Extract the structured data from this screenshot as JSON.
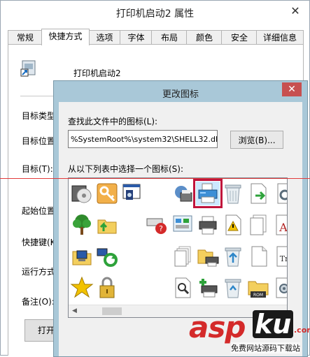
{
  "properties": {
    "title": "打印机启动2 属性",
    "close_glyph": "✕",
    "tabs": [
      "常规",
      "快捷方式",
      "选项",
      "字体",
      "布局",
      "颜色",
      "安全",
      "详细信息"
    ],
    "shortcut_name": "打印机启动2",
    "fields": [
      "目标类型",
      "目标位置",
      "目标(T):",
      "起始位置",
      "快捷键(K",
      "运行方式",
      "备注(O):"
    ],
    "open_button": "打开"
  },
  "dialog": {
    "title": "更改图标",
    "close_glyph": "✕",
    "find_label": "查找此文件中的图标(L):",
    "path_value": "%SystemRoot%\\system32\\SHELL32.dll",
    "browse_label": "浏览(B)...",
    "list_label": "从以下列表中选择一个图标(S):",
    "selected_icon": "printer-icon",
    "icon_names": [
      "cd-drive-icon",
      "key-icon",
      "window-app-icon",
      "blank-icon",
      "network-printer-icon",
      "printer-icon",
      "recycle-bin-empty-icon",
      "document-shortcut-icon",
      "gear-document-icon",
      "tree-icon",
      "folder-arrow-icon",
      "blank-icon",
      "keyboard-error-icon",
      "control-panel-icon",
      "printer-network-icon",
      "warning-document-icon",
      "documents-icon",
      "font-icon",
      "computer-icon",
      "network-refresh-icon",
      "blank-icon",
      "blank-icon",
      "documents-stack-icon",
      "folder-printer-icon",
      "recycle-bin-full-icon",
      "blank-document-icon",
      "text-document-icon",
      "star-icon",
      "padlock-icon",
      "blank-icon",
      "blank-icon",
      "search-document-icon",
      "add-printer-icon",
      "recycle-bin-icon",
      "folder-rom-icon",
      "settings-document-icon"
    ]
  },
  "watermark": {
    "brand_a": "asp",
    "brand_b": "ku",
    "brand_c": ".com",
    "tagline": "免费网站源码下载站"
  },
  "colors": {
    "selection": "#c0143c",
    "dialog_frame": "#a9c8d8",
    "close_button": "#c75050",
    "guide_line": "#e23b3b"
  }
}
